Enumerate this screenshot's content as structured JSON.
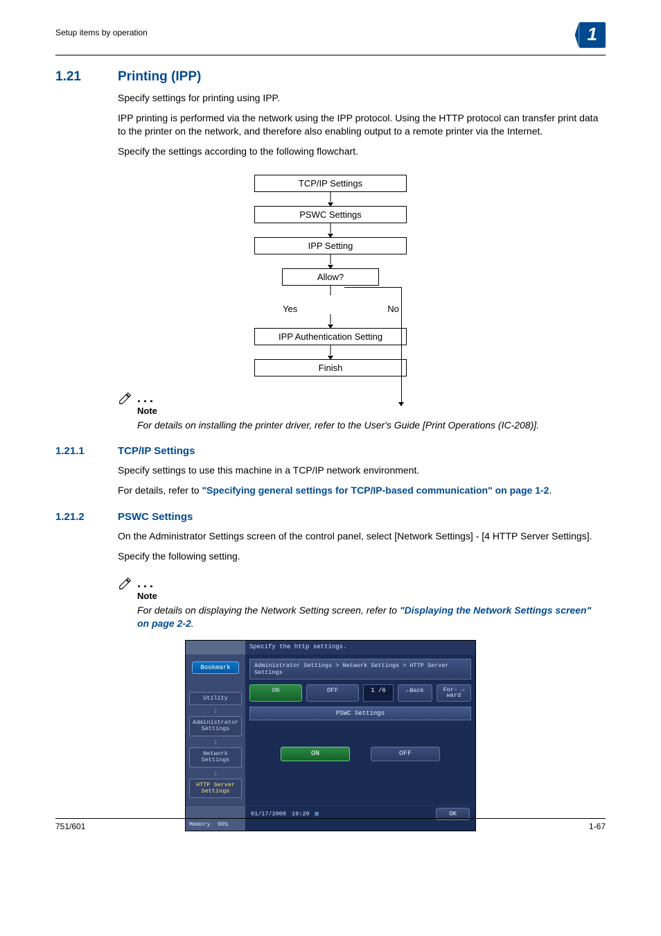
{
  "header": {
    "breadcrumb": "Setup items by operation",
    "chapter_num": "1"
  },
  "sec121": {
    "num": "1.21",
    "title": "Printing (IPP)",
    "p1": "Specify settings for printing using IPP.",
    "p2": "IPP printing is performed via the network using the IPP protocol. Using the HTTP protocol can transfer print data to the printer on the network, and therefore also enabling output to a remote printer via the Internet.",
    "p3": "Specify the settings according to the following flowchart."
  },
  "flow": {
    "b1": "TCP/IP Settings",
    "b2": "PSWC Settings",
    "b3": "IPP Setting",
    "b4": "Allow?",
    "yes": "Yes",
    "no": "No",
    "b5": "IPP Authentication Setting",
    "b6": "Finish"
  },
  "note1": {
    "label": "Note",
    "text": "For details on installing the printer driver, refer to the User's Guide [Print Operations (IC-208)]."
  },
  "sec1211": {
    "num": "1.21.1",
    "title": "TCP/IP Settings",
    "p1": "Specify settings to use this machine in a TCP/IP network environment.",
    "p2_pre": "For details, refer to ",
    "p2_link": "\"Specifying general settings for TCP/IP-based communication\" on page 1-2",
    "p2_post": "."
  },
  "sec1212": {
    "num": "1.21.2",
    "title": "PSWC Settings",
    "p1": "On the Administrator Settings screen of the control panel, select [Network Settings] - [4 HTTP Server Settings].",
    "p2": "Specify the following setting."
  },
  "note2": {
    "label": "Note",
    "text_pre": "For details on displaying the Network Setting screen, refer to ",
    "link": "\"Displaying the Network Settings screen\" on page 2-2",
    "text_post": "."
  },
  "panel": {
    "instruction": "Specify the http settings.",
    "bookmark": "Bookmark",
    "side_utility": "Utility",
    "side_admin": "Administrator Settings",
    "side_network": "Network Settings",
    "side_http": "HTTP Server Settings",
    "crumb": "Administrator Settings > Network Settings > HTTP Server Settings",
    "on": "ON",
    "off": "OFF",
    "page": "1 /6",
    "back": "←Back",
    "forward": "For- →\nward",
    "center_title": "PSWC Settings",
    "opt_on": "ON",
    "opt_off": "OFF",
    "date": "01/17/2008",
    "time": "19:29",
    "memory": "Memory",
    "mempct": "90%",
    "ok": "OK"
  },
  "footer": {
    "left": "751/601",
    "right": "1-67"
  }
}
